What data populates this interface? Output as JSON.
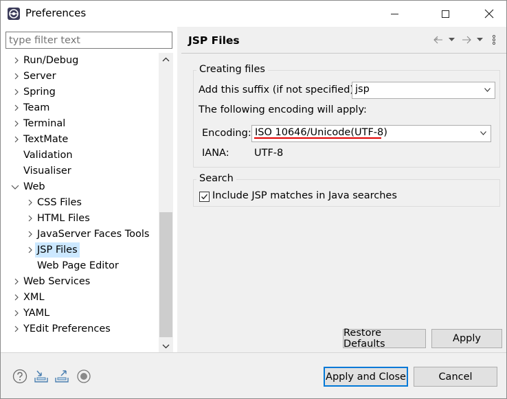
{
  "window": {
    "title": "Preferences"
  },
  "sidebar": {
    "filter_placeholder": "type filter text",
    "items": [
      {
        "label": "Run/Debug"
      },
      {
        "label": "Server"
      },
      {
        "label": "Spring"
      },
      {
        "label": "Team"
      },
      {
        "label": "Terminal"
      },
      {
        "label": "TextMate"
      },
      {
        "label": "Validation"
      },
      {
        "label": "Visualiser"
      },
      {
        "label": "Web"
      },
      {
        "label": "CSS Files"
      },
      {
        "label": "HTML Files"
      },
      {
        "label": "JavaServer Faces Tools"
      },
      {
        "label": "JSP Files"
      },
      {
        "label": "Web Page Editor"
      },
      {
        "label": "Web Services"
      },
      {
        "label": "XML"
      },
      {
        "label": "YAML"
      },
      {
        "label": "YEdit Preferences"
      }
    ]
  },
  "page": {
    "title": "JSP Files",
    "creating": {
      "group_label": "Creating files",
      "suffix_label": "Add this suffix (if not specified):",
      "suffix_value": "jsp",
      "encoding_note": "The following encoding will apply:",
      "encoding_label": "Encoding:",
      "encoding_value": "ISO 10646/Unicode(UTF-8)",
      "iana_label": "IANA:",
      "iana_value": "UTF-8"
    },
    "search": {
      "group_label": "Search",
      "include_label": "Include JSP matches in Java searches",
      "include_checked": true
    },
    "restore_defaults": "Restore Defaults",
    "apply": "Apply"
  },
  "footer": {
    "apply_close": "Apply and Close",
    "cancel": "Cancel"
  },
  "colors": {
    "selection": "#cce8ff",
    "highlight_underline": "#e00000",
    "default_button_border": "#0078d7"
  }
}
